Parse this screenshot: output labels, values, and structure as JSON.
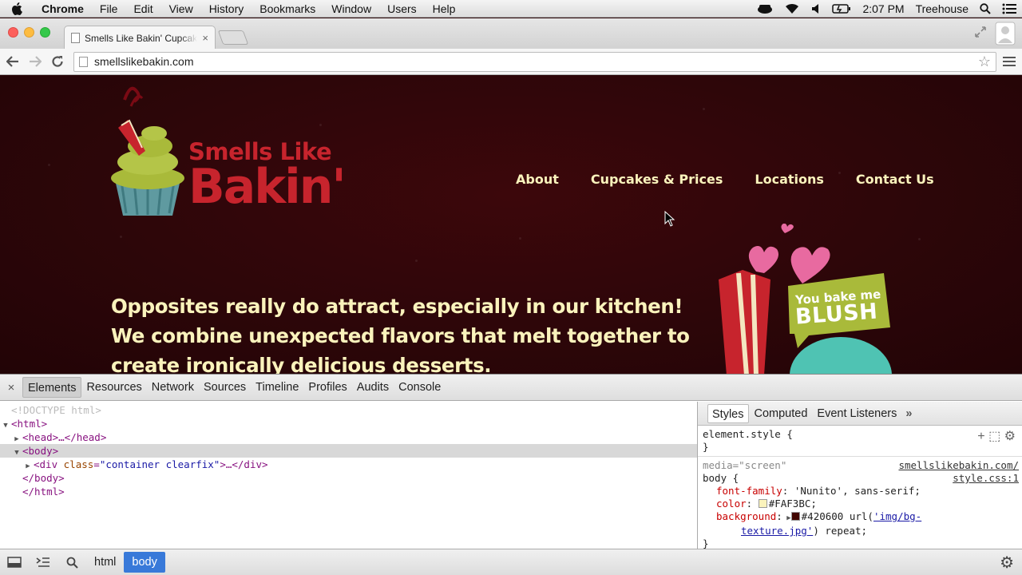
{
  "menubar": {
    "app_name": "Chrome",
    "menus": [
      "File",
      "Edit",
      "View",
      "History",
      "Bookmarks",
      "Window",
      "Users",
      "Help"
    ],
    "clock": "2:07 PM",
    "user": "Treehouse"
  },
  "browser": {
    "tab_title": "Smells Like Bakin' Cupcakes",
    "tab_close": "×",
    "url": "smellslikebakin.com"
  },
  "site": {
    "nav": [
      "About",
      "Cupcakes & Prices",
      "Locations",
      "Contact Us"
    ],
    "logo_line_1": "Smells Like",
    "logo_line_2": "Bakin'",
    "tagline": "Opposites really do attract, especially in our kitchen! We combine unexpected flavors that melt together to create ironically delicious desserts.",
    "promo_line_1": "You bake me",
    "promo_line_2": "BLUSH",
    "colors": {
      "background": "#420600",
      "text": "#FAF3BC",
      "logo": "#c7242d"
    }
  },
  "devtools": {
    "close": "×",
    "tabs": [
      "Elements",
      "Resources",
      "Network",
      "Sources",
      "Timeline",
      "Profiles",
      "Audits",
      "Console"
    ],
    "active_tab": "Elements",
    "dom": {
      "doctype": "<!DOCTYPE html>",
      "html_open": "<html>",
      "head": "<head>…</head>",
      "body_open": "<body>",
      "div_tag_open": "<div ",
      "div_attr_name": "class",
      "div_attr_value": "\"container clearfix\"",
      "div_rest": ">…</div>",
      "body_close": "</body>",
      "html_close": "</html>"
    },
    "styles_tabs": [
      "Styles",
      "Computed",
      "Event Listeners"
    ],
    "styles_more": "»",
    "element_style_open": "element.style {",
    "element_style_close": "}",
    "rule": {
      "media": "media=\"screen\"",
      "selector": "body {",
      "source_1": "smellslikebakin.com/",
      "source_2": "style.css:1",
      "prop_1": "font-family",
      "val_1": "'Nunito', sans-serif;",
      "prop_2": "color",
      "val_2": "#FAF3BC;",
      "swatch_2": "#FAF3BC",
      "prop_3": "background",
      "val_3_color": "#420600",
      "swatch_3": "#420600",
      "val_3_url_pre": " url(",
      "val_3_link_1": "'img/bg-",
      "val_3_link_2": "texture.jpg'",
      "val_3_rest": ") repeat;",
      "close": "}"
    },
    "breadcrumbs": [
      "html",
      "body"
    ],
    "active_crumb": "body"
  }
}
